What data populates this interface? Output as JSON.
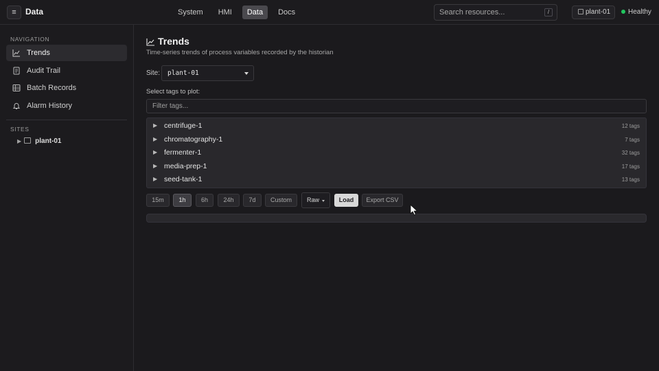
{
  "app": {
    "title": "Data",
    "menu_icon": "hamburger-icon"
  },
  "nav": {
    "tabs": [
      {
        "label": "System"
      },
      {
        "label": "HMI"
      },
      {
        "label": "Data",
        "active": true
      },
      {
        "label": "Docs"
      }
    ]
  },
  "search": {
    "placeholder": "Search resources...",
    "shortcut": "/"
  },
  "header": {
    "site": "plant-01",
    "status": "Healthy",
    "status_color": "#22c55e"
  },
  "sidebar": {
    "nav_title": "NAVIGATION",
    "items": [
      {
        "label": "Trends",
        "icon": "line-chart-icon",
        "active": true
      },
      {
        "label": "Audit Trail",
        "icon": "document-icon"
      },
      {
        "label": "Batch Records",
        "icon": "grid-icon"
      },
      {
        "label": "Alarm History",
        "icon": "bell-icon"
      }
    ],
    "sites_title": "SITES",
    "sites": [
      {
        "label": "plant-01",
        "icon": "building-icon"
      }
    ]
  },
  "main": {
    "title": "Trends",
    "subtitle": "Time-series trends of process variables recorded by the historian",
    "site_label": "Site:",
    "site_value": "plant-01",
    "tags_label": "Select tags to plot:",
    "filter_placeholder": "Filter tags...",
    "tag_groups": [
      {
        "name": "centrifuge-1",
        "count": "12 tags"
      },
      {
        "name": "chromatography-1",
        "count": "7 tags"
      },
      {
        "name": "fermenter-1",
        "count": "32 tags"
      },
      {
        "name": "media-prep-1",
        "count": "17 tags"
      },
      {
        "name": "seed-tank-1",
        "count": "13 tags"
      }
    ],
    "ranges": [
      "15m",
      "1h",
      "6h",
      "24h",
      "7d",
      "Custom"
    ],
    "active_range": "1h",
    "mode": "Raw",
    "load_label": "Load",
    "export_label": "Export CSV"
  }
}
